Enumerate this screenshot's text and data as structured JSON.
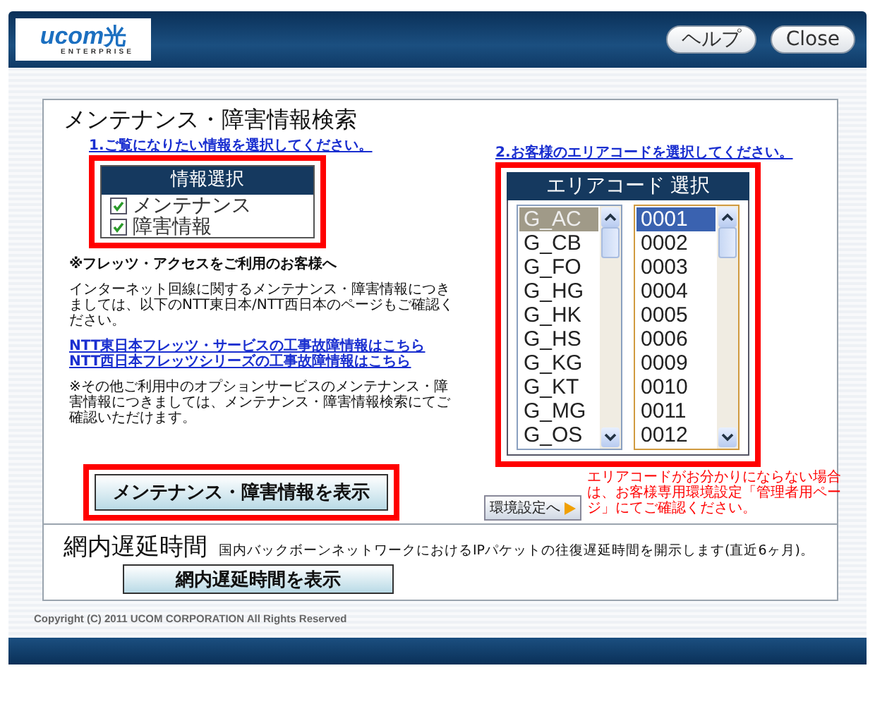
{
  "header": {
    "logo": "ucom",
    "logo_mark": "光",
    "logo_sub": "ENTERPRISE",
    "buttons": [
      "ヘルプ",
      "Close"
    ]
  },
  "search": {
    "title": "メンテナンス・障害情報検索",
    "info_select": {
      "instruction": "1.ご覧になりたい情報を選択してください。",
      "heading": "情報選択",
      "highlighted": true,
      "options": [
        {
          "label": "メンテナンス",
          "checked": true
        },
        {
          "label": "障害情報",
          "checked": true
        }
      ]
    },
    "notes": [
      {
        "kind": "heading",
        "text": "※フレッツ・アクセスをご利用のお客様へ"
      },
      {
        "kind": "paragraph",
        "text": "インターネット回線に関するメンテナンス・障害情報につきましては、以下のNTT東日本/NTT西日本のページもご確認ください。"
      },
      {
        "kind": "link",
        "text": "NTT東日本フレッツ・サービスの工事故障情報はこちら"
      },
      {
        "kind": "link",
        "text": "NTT西日本フレッツシリーズの工事故障情報はこちら"
      },
      {
        "kind": "paragraph",
        "text": "※その他ご利用中のオプションサービスのメンテナンス・障害情報につきましては、メンテナンス・障害情報検索にてご確認いただけます。"
      }
    ],
    "area_select": {
      "instruction": "2.お客様のエリアコードを選択してください。",
      "heading": "エリアコード 選択",
      "highlighted": true,
      "groups": [
        {
          "label": "G_AC",
          "selected": true
        },
        {
          "label": "G_CB",
          "selected": false
        },
        {
          "label": "G_FO",
          "selected": false
        },
        {
          "label": "G_HG",
          "selected": false
        },
        {
          "label": "G_HK",
          "selected": false
        },
        {
          "label": "G_HS",
          "selected": false
        },
        {
          "label": "G_KG",
          "selected": false
        },
        {
          "label": "G_KT",
          "selected": false
        },
        {
          "label": "G_MG",
          "selected": false
        },
        {
          "label": "G_OS",
          "selected": false
        }
      ],
      "codes": [
        {
          "label": "0001",
          "selected": true
        },
        {
          "label": "0002",
          "selected": false
        },
        {
          "label": "0003",
          "selected": false
        },
        {
          "label": "0004",
          "selected": false
        },
        {
          "label": "0005",
          "selected": false
        },
        {
          "label": "0006",
          "selected": false
        },
        {
          "label": "0009",
          "selected": false
        },
        {
          "label": "0010",
          "selected": false
        },
        {
          "label": "0011",
          "selected": false
        },
        {
          "label": "0012",
          "selected": false
        }
      ]
    },
    "settings_button": "環境設定へ",
    "area_note": "エリアコードがお分かりにならない場合は、お客様専用環境設定「管理者用ページ」にてご確認ください。",
    "show_button": {
      "label": "メンテナンス・障害情報を表示",
      "highlighted": true
    }
  },
  "latency": {
    "title": "網内遅延時間",
    "description": "国内バックボーンネットワークにおけるIPパケットの往復遅延時間を開示します(直近6ヶ月)。",
    "button": "網内遅延時間を表示"
  },
  "footer": {
    "copyright": "Copyright (C) 2011 UCOM CORPORATION All Rights Reserved"
  }
}
